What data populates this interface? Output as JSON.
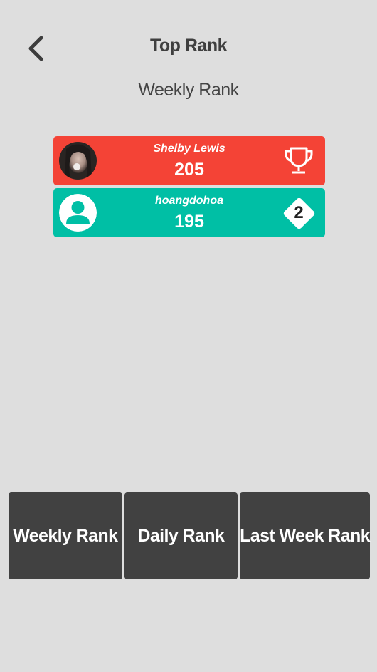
{
  "header": {
    "title": "Top Rank",
    "subtitle": "Weekly Rank",
    "back_icon": "chevron-left-icon"
  },
  "ranking": [
    {
      "rank": 1,
      "name": "Shelby Lewis",
      "score": "205",
      "color": "#f44336",
      "avatar": "user-photo",
      "badge_icon": "trophy-icon"
    },
    {
      "rank": 2,
      "name": "hoangdohoa",
      "score": "195",
      "color": "#00bfa5",
      "avatar": "default-user-icon",
      "badge_icon": "diamond-badge-icon",
      "badge_label": "2"
    }
  ],
  "tabs": [
    {
      "label": "Weekly Rank"
    },
    {
      "label": "Daily Rank"
    },
    {
      "label": "Last Week Rank"
    }
  ],
  "colors": {
    "background": "#dedede",
    "button": "#414141",
    "first_place": "#f44336",
    "second_place": "#00bfa5"
  }
}
